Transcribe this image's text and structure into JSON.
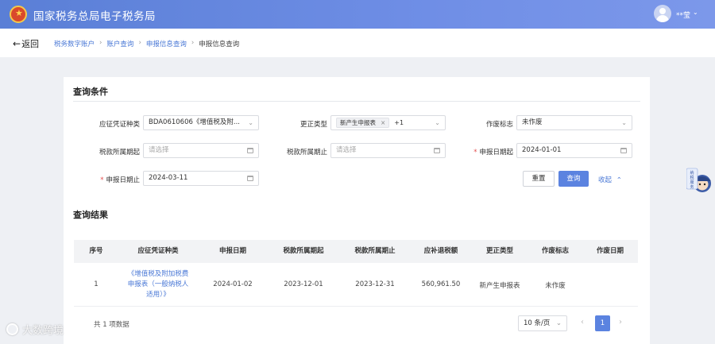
{
  "header": {
    "app_title": "国家税务总局电子税务局",
    "user_name": "**莹",
    "user_chevron": "⌄"
  },
  "nav": {
    "back_label": "返回",
    "breadcrumbs": [
      "税务数字账户",
      "账户查询",
      "申报信息查询",
      "申报信息查询"
    ]
  },
  "query": {
    "section_title": "查询条件",
    "fields": {
      "voucher_type": {
        "label": "应征凭证种类",
        "value": "BDA0610606《增值税及附..."
      },
      "correction_type": {
        "label": "更正类型",
        "tag": "新产生申报表",
        "tag_more": "+1"
      },
      "void_flag": {
        "label": "作废标志",
        "value": "未作废"
      },
      "tax_period_start": {
        "label": "税款所属期起",
        "placeholder": "请选择"
      },
      "tax_period_end": {
        "label": "税款所属期止",
        "placeholder": "请选择"
      },
      "declare_date_start": {
        "label": "申报日期起",
        "value": "2024-01-01"
      },
      "declare_date_end": {
        "label": "申报日期止",
        "value": "2024-03-11"
      }
    },
    "buttons": {
      "reset": "重置",
      "query": "查询",
      "collapse": "收起"
    }
  },
  "results": {
    "section_title": "查询结果",
    "columns": [
      "序号",
      "应征凭证种类",
      "申报日期",
      "税款所属期起",
      "税款所属期止",
      "应补退税额",
      "更正类型",
      "作废标志",
      "作废日期"
    ],
    "rows": [
      {
        "index": "1",
        "voucher_lines": [
          "《增值税及附加税费",
          "申报表（一般纳税人",
          "适用）》"
        ],
        "declare_date": "2024-01-02",
        "period_start": "2023-12-01",
        "period_end": "2023-12-31",
        "amount": "560,961.50",
        "correction_type": "新产生申报表",
        "void_flag": "未作废",
        "void_date": ""
      }
    ]
  },
  "pagination": {
    "total_text": "共 1 项数据",
    "page_size": "10 条/页",
    "current_page": "1"
  },
  "mascot_text": "纳税服务",
  "watermark": "大数跨境",
  "colors": {
    "header_bg": "#5a7fd6",
    "accent": "#5b83e0",
    "link": "#4a78d6",
    "required": "#e34d4d"
  }
}
